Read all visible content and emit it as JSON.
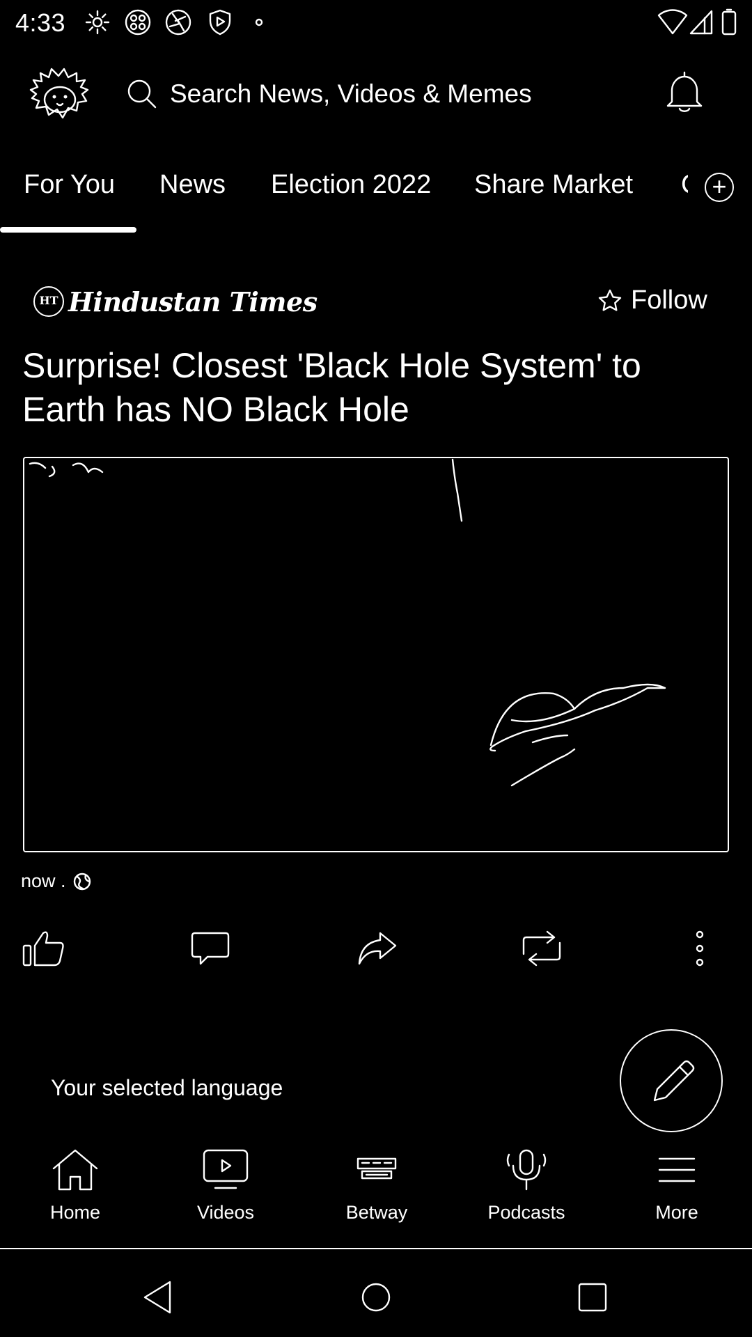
{
  "status_bar": {
    "time": "4:33",
    "left_icons": [
      "gear-icon",
      "app-grid-icon",
      "shutter-icon",
      "shield-play-icon",
      "dot-icon"
    ],
    "right_icons": [
      "wifi-icon",
      "cell-signal-icon",
      "battery-icon"
    ]
  },
  "header": {
    "logo_icon": "hedgehog-logo-icon",
    "search_placeholder": "Search News, Videos & Memes",
    "notification_icon": "bell-icon"
  },
  "tabs": {
    "items": [
      {
        "label": "For You",
        "active": true
      },
      {
        "label": "News",
        "active": false
      },
      {
        "label": "Election 2022",
        "active": false
      },
      {
        "label": "Share Market",
        "active": false
      },
      {
        "label": "C",
        "active": false
      }
    ],
    "add_icon": "plus-circle-icon"
  },
  "article": {
    "publisher_badge": "HT",
    "publisher": "Hindustan Times",
    "follow_label": "Follow",
    "headline": "Surprise! Closest 'Black Hole System' to Earth has NO Black Hole",
    "image_icon": "space-planet-image",
    "timestamp": "now .",
    "actions": [
      "thumbs-up-icon",
      "comment-icon",
      "share-icon",
      "repost-icon",
      "more-vertical-icon"
    ]
  },
  "language_banner": {
    "text": "Your selected language"
  },
  "fab": {
    "icon": "pencil-icon"
  },
  "bottom_nav": {
    "items": [
      {
        "label": "Home",
        "icon": "home-icon"
      },
      {
        "label": "Videos",
        "icon": "video-icon"
      },
      {
        "label": "Betway",
        "icon": "betway-logo-icon"
      },
      {
        "label": "Podcasts",
        "icon": "microphone-icon"
      },
      {
        "label": "More",
        "icon": "menu-icon"
      }
    ]
  },
  "system_nav": [
    "back-icon",
    "home-circle-icon",
    "recents-icon"
  ]
}
